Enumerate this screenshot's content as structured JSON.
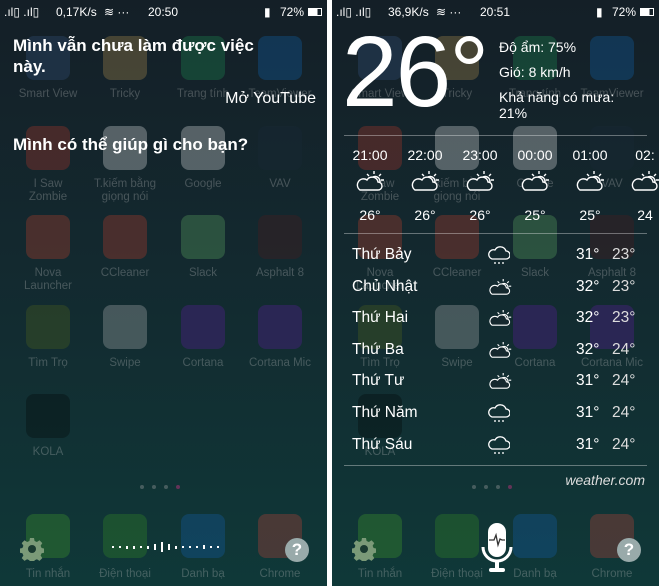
{
  "background_apps": [
    {
      "label": "Smart View",
      "color": "#3a5a8a"
    },
    {
      "label": "Tricky",
      "color": "#c9a055"
    },
    {
      "label": "Trang tính",
      "color": "#1e9d58"
    },
    {
      "label": "TeamViewer",
      "color": "#0e6fc4"
    },
    {
      "label": "I Saw Zombie",
      "color": "#c83a2a"
    },
    {
      "label": "T.kiếm bằng giọng nói",
      "color": "#ffffff"
    },
    {
      "label": "Google",
      "color": "#ffffff"
    },
    {
      "label": "VAV",
      "color": "#1b2b3a"
    },
    {
      "label": "Nova Launcher",
      "color": "#d9442a"
    },
    {
      "label": "CCleaner",
      "color": "#d8402a"
    },
    {
      "label": "Slack",
      "color": "#6bbf6a"
    },
    {
      "label": "Asphalt 8",
      "color": "#5a1a1a"
    },
    {
      "label": "Tìm Trọ",
      "color": "#5a6d1a"
    },
    {
      "label": "Swipe",
      "color": "#c9c9c9"
    },
    {
      "label": "Cortana",
      "color": "#6a1ab0"
    },
    {
      "label": "Cortana Mic",
      "color": "#6a1ab0"
    },
    {
      "label": "KOLA",
      "color": "#000000"
    }
  ],
  "dock": [
    {
      "label": "Tin nhắn",
      "color": "#4caf28"
    },
    {
      "label": "Điện thoại",
      "color": "#3c9a22"
    },
    {
      "label": "Danh bạ",
      "color": "#1565c0"
    },
    {
      "label": "Chrome",
      "color": "#db4437"
    }
  ],
  "left": {
    "status": {
      "signal": ".ıl▯ .ıl▯",
      "speed": "0,17K/s",
      "wifi": "wifi-icon ···",
      "time": "20:50",
      "battery": "72%"
    },
    "assistant_reply": "Mình vẫn chưa làm được việc này.",
    "user_query": "Mở YouTube",
    "assistant_prompt": "Mình có thể giúp gì cho bạn?"
  },
  "right": {
    "status": {
      "signal": ".ıl▯ .ıl▯",
      "speed": "36,9K/s",
      "wifi": "wifi-icon ···",
      "time": "20:51",
      "battery": "72%"
    },
    "current_temp": "26°",
    "humidity": "Độ ẩm: 75%",
    "wind": "Gió: 8 km/h",
    "rain_label": "Khả năng có mưa:",
    "rain_value": "21%",
    "hourly": [
      {
        "time": "21:00",
        "icon": "partly-cloudy-icon",
        "temp": "26°"
      },
      {
        "time": "22:00",
        "icon": "partly-cloudy-icon",
        "temp": "26°"
      },
      {
        "time": "23:00",
        "icon": "partly-cloudy-icon",
        "temp": "26°"
      },
      {
        "time": "00:00",
        "icon": "partly-cloudy-icon",
        "temp": "25°"
      },
      {
        "time": "01:00",
        "icon": "partly-cloudy-icon",
        "temp": "25°"
      },
      {
        "time": "02:",
        "icon": "partly-cloudy-icon",
        "temp": "24"
      }
    ],
    "daily": [
      {
        "day": "Thứ Bảy",
        "icon": "rain-cloud-icon",
        "high": "31°",
        "low": "23°"
      },
      {
        "day": "Chủ Nhật",
        "icon": "partly-cloudy-icon",
        "high": "32°",
        "low": "23°"
      },
      {
        "day": "Thứ Hai",
        "icon": "partly-cloudy-icon",
        "high": "32°",
        "low": "23°"
      },
      {
        "day": "Thứ Ba",
        "icon": "partly-cloudy-icon",
        "high": "32°",
        "low": "24°"
      },
      {
        "day": "Thứ Tư",
        "icon": "partly-cloudy-icon",
        "high": "31°",
        "low": "24°"
      },
      {
        "day": "Thứ Năm",
        "icon": "rain-cloud-icon",
        "high": "31°",
        "low": "24°"
      },
      {
        "day": "Thứ Sáu",
        "icon": "rain-cloud-icon",
        "high": "31°",
        "low": "24°"
      }
    ],
    "source": "weather.com"
  },
  "help_label": "?"
}
